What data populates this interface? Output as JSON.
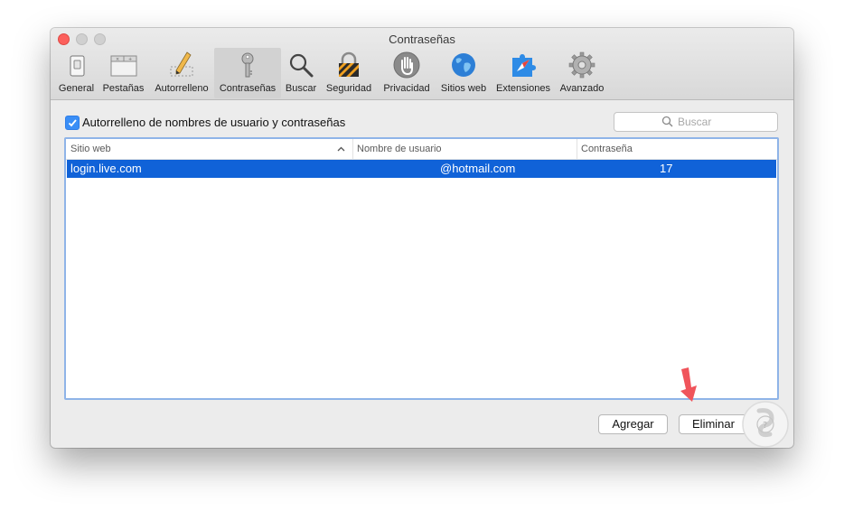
{
  "window": {
    "title": "Contraseñas"
  },
  "toolbar": {
    "items": [
      {
        "label": "General",
        "icon": "switch-icon"
      },
      {
        "label": "Pestañas",
        "icon": "tabs-icon"
      },
      {
        "label": "Autorrelleno",
        "icon": "pencil-icon"
      },
      {
        "label": "Contraseñas",
        "icon": "key-icon",
        "selected": true
      },
      {
        "label": "Buscar",
        "icon": "magnifier-icon"
      },
      {
        "label": "Seguridad",
        "icon": "lock-icon"
      },
      {
        "label": "Privacidad",
        "icon": "hand-icon"
      },
      {
        "label": "Sitios web",
        "icon": "globe-icon"
      },
      {
        "label": "Extensiones",
        "icon": "puzzle-icon"
      },
      {
        "label": "Avanzado",
        "icon": "gear-icon"
      }
    ]
  },
  "autofill": {
    "label": "Autorrelleno de nombres de usuario y contraseñas",
    "checked": true
  },
  "search": {
    "placeholder": "Buscar"
  },
  "table": {
    "columns": [
      "Sitio web",
      "Nombre de usuario",
      "Contraseña"
    ],
    "rows": [
      {
        "site": "login.live.com",
        "username": "@hotmail.com",
        "password": "17",
        "selected": true
      }
    ]
  },
  "buttons": {
    "add": "Agregar",
    "remove": "Eliminar"
  },
  "colors": {
    "selection": "#1062d8",
    "accent": "#3a8ef6",
    "close": "#fc605c",
    "arrow": "#f0545b"
  }
}
